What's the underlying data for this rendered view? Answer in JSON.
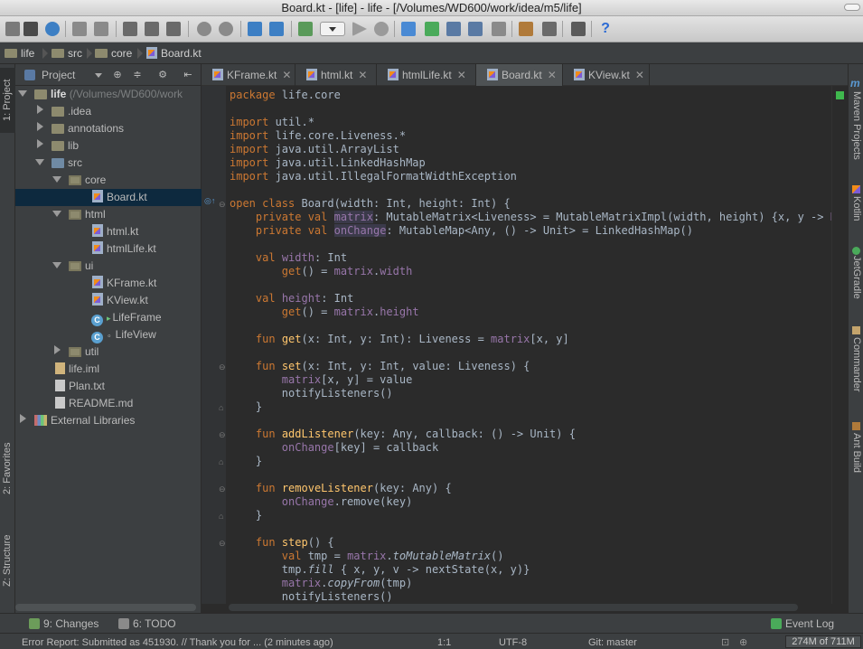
{
  "window": {
    "title": "Board.kt - [life] - life - [/Volumes/WD600/work/idea/m5/life]"
  },
  "colors": {
    "accent_selection": "#0d293e",
    "keyword": "#cc7832",
    "function": "#ffc66d",
    "property": "#9876aa",
    "editor_bg": "#2b2b2b",
    "panel_bg": "#3c3f41"
  },
  "navbar": {
    "crumbs": [
      "life",
      "src",
      "core",
      "Board.kt"
    ]
  },
  "left_strip": {
    "project": "1: Project",
    "favorites": "2: Favorites",
    "structure": "Z: Structure"
  },
  "right_strip": {
    "maven": "Maven Projects",
    "kotlin": "Kotlin",
    "gradle": "JetGradle",
    "commander": "Commander",
    "ant": "Ant Build"
  },
  "project_panel": {
    "view_label": "Project"
  },
  "tree": [
    {
      "label": "life",
      "extra": "(/Volumes/WD600/work"
    },
    {
      "label": ".idea"
    },
    {
      "label": "annotations"
    },
    {
      "label": "lib"
    },
    {
      "label": "src"
    },
    {
      "label": "core"
    },
    {
      "label": "Board.kt"
    },
    {
      "label": "html"
    },
    {
      "label": "html.kt"
    },
    {
      "label": "htmlLife.kt"
    },
    {
      "label": "ui"
    },
    {
      "label": "KFrame.kt"
    },
    {
      "label": "KView.kt"
    },
    {
      "label": "LifeFrame"
    },
    {
      "label": "LifeView"
    },
    {
      "label": "util"
    },
    {
      "label": "life.iml"
    },
    {
      "label": "Plan.txt"
    },
    {
      "label": "README.md"
    },
    {
      "label": "External Libraries"
    }
  ],
  "tabs": [
    {
      "label": "KFrame.kt"
    },
    {
      "label": "html.kt"
    },
    {
      "label": "htmlLife.kt"
    },
    {
      "label": "Board.kt"
    },
    {
      "label": "KView.kt"
    }
  ],
  "bottom_tabs": {
    "changes": "9: Changes",
    "todo": "6: TODO",
    "event_log": "Event Log"
  },
  "status": {
    "message": "Error Report: Submitted as 451930. // Thank you for ... (2 minutes ago)",
    "position": "1:1",
    "encoding": "UTF-8",
    "vcs": "Git: master",
    "memory": "274M of 711M"
  }
}
